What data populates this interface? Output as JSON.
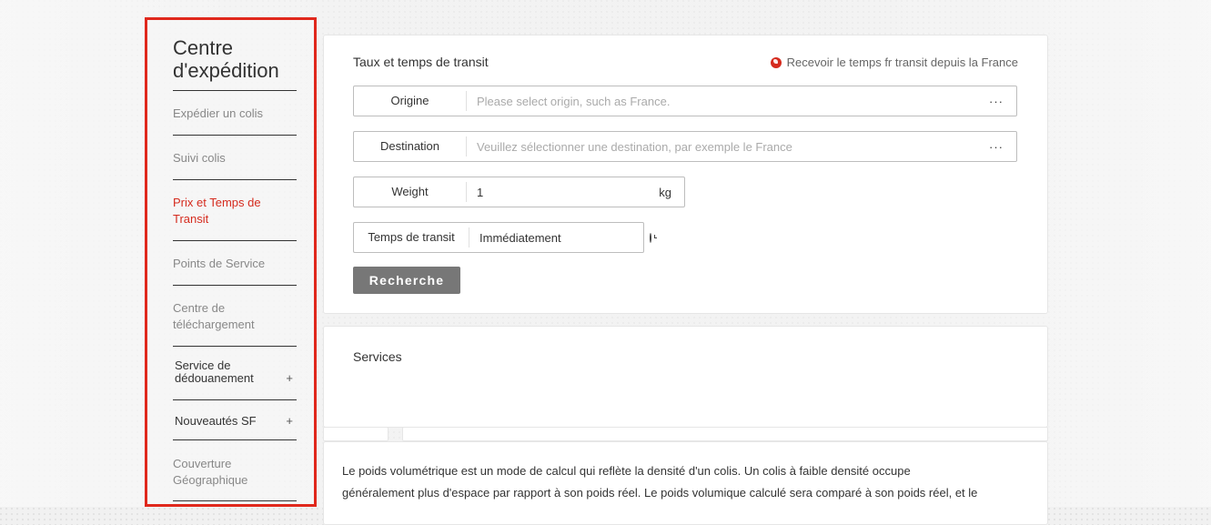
{
  "sidebar": {
    "title_line1": "Centre",
    "title_line2": "d'expédition",
    "items": [
      {
        "label": "Expédier un colis"
      },
      {
        "label": "Suivi colis"
      },
      {
        "label_line1": "Prix et Temps de",
        "label_line2": "Transit"
      },
      {
        "label": "Points de Service"
      },
      {
        "label_line1": "Centre de",
        "label_line2": "téléchargement"
      },
      {
        "label_line1": "Service de",
        "label_line2": "dédouanement",
        "expander": "+"
      },
      {
        "label": "Nouveautés SF",
        "expander": "+"
      },
      {
        "label_line1": "Couverture",
        "label_line2": "Géographique"
      }
    ],
    "active_color": "#d52b1e",
    "highlight_border": "#e0281c"
  },
  "rates": {
    "title": "Taux et temps de transit",
    "france_link": "Recevoir le temps fr transit depuis la France",
    "origin": {
      "label": "Origine",
      "placeholder": "Please select origin, such as France.",
      "more": "···"
    },
    "destination": {
      "label": "Destination",
      "placeholder": "Veuillez sélectionner une destination, par exemple le France",
      "more": "···"
    },
    "weight": {
      "label": "Weight",
      "value": "1",
      "unit": "kg"
    },
    "transit": {
      "label": "Temps de transit",
      "value": "Immédiatement"
    },
    "search_button": "Recherche"
  },
  "services": {
    "title": "Services"
  },
  "info": {
    "line1": "Le poids volumétrique est un mode de calcul qui reflète la densité d'un colis. Un colis à faible densité occupe",
    "line2": "généralement plus d'espace par rapport à son poids réel. Le poids volumique calculé sera comparé à son poids réel, et le"
  }
}
